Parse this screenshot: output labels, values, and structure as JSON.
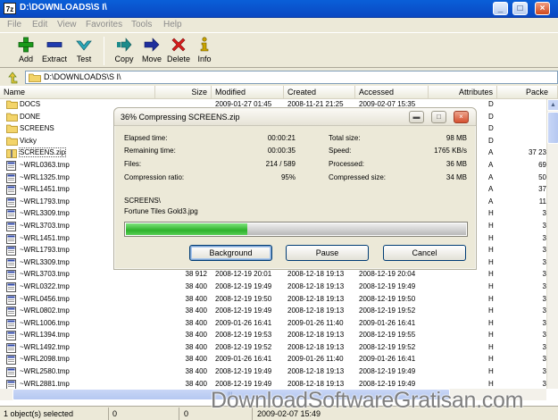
{
  "window": {
    "title": "D:\\DOWNLOADS\\S I\\"
  },
  "menu": [
    "File",
    "Edit",
    "View",
    "Favorites",
    "Tools",
    "Help"
  ],
  "toolbar": [
    {
      "label": "Add",
      "icon": "plus-icon",
      "color": "#1a9a1a"
    },
    {
      "label": "Extract",
      "icon": "minus-icon",
      "color": "#1f3bb0"
    },
    {
      "label": "Test",
      "icon": "check-icon",
      "color": "#2aa7b8"
    },
    {
      "label": "Copy",
      "icon": "copy-arrow-icon",
      "color": "#1d8b8b"
    },
    {
      "label": "Move",
      "icon": "move-arrow-icon",
      "color": "#1f2f9c"
    },
    {
      "label": "Delete",
      "icon": "delete-x-icon",
      "color": "#d81c1c"
    },
    {
      "label": "Info",
      "icon": "info-icon",
      "color": "#c9a400"
    }
  ],
  "address": {
    "path": "D:\\DOWNLOADS\\S I\\"
  },
  "columns": [
    "Name",
    "Size",
    "Modified",
    "Created",
    "Accessed",
    "Attributes",
    "Packe"
  ],
  "rows": [
    {
      "name": "DOCS",
      "type": "folder",
      "size": "",
      "modified": "2009-01-27 01:45",
      "created": "2008-11-21 21:25",
      "accessed": "2009-02-07 15:35",
      "attr": "D",
      "packed": ""
    },
    {
      "name": "DONE",
      "type": "folder",
      "size": "",
      "modified": "",
      "created": "",
      "accessed": "",
      "attr": "D",
      "packed": ""
    },
    {
      "name": "SCREENS",
      "type": "folder",
      "size": "",
      "modified": "",
      "created": "",
      "accessed": "",
      "attr": "D",
      "packed": ""
    },
    {
      "name": "Vicky",
      "type": "folder",
      "size": "",
      "modified": "",
      "created": "",
      "accessed": "",
      "attr": "D",
      "packed": ""
    },
    {
      "name": "SCREENS.zip",
      "type": "zip",
      "size": "",
      "modified": "",
      "created": "",
      "accessed": "",
      "attr": "A",
      "packed": "37 23"
    },
    {
      "name": "~WRL0363.tmp",
      "type": "file",
      "size": "",
      "modified": "",
      "created": "",
      "accessed": "",
      "attr": "A",
      "packed": "69"
    },
    {
      "name": "~WRL1325.tmp",
      "type": "file",
      "size": "",
      "modified": "",
      "created": "",
      "accessed": "",
      "attr": "A",
      "packed": "50"
    },
    {
      "name": "~WRL1451.tmp",
      "type": "file",
      "size": "",
      "modified": "",
      "created": "",
      "accessed": "",
      "attr": "A",
      "packed": "37"
    },
    {
      "name": "~WRL1793.tmp",
      "type": "file",
      "size": "",
      "modified": "",
      "created": "",
      "accessed": "",
      "attr": "A",
      "packed": "11"
    },
    {
      "name": "~WRL3309.tmp",
      "type": "file",
      "size": "",
      "modified": "",
      "created": "",
      "accessed": "",
      "attr": "H",
      "packed": "3"
    },
    {
      "name": "~WRL3703.tmp",
      "type": "file",
      "size": "",
      "modified": "",
      "created": "",
      "accessed": "",
      "attr": "H",
      "packed": "3"
    },
    {
      "name": "~WRL1451.tmp",
      "type": "file",
      "size": "",
      "modified": "",
      "created": "",
      "accessed": "",
      "attr": "H",
      "packed": "3"
    },
    {
      "name": "~WRL1793.tmp",
      "type": "file",
      "size": "",
      "modified": "",
      "created": "",
      "accessed": "",
      "attr": "H",
      "packed": "3"
    },
    {
      "name": "~WRL3309.tmp",
      "type": "file",
      "size": "",
      "modified": "",
      "created": "",
      "accessed": "",
      "attr": "H",
      "packed": "3"
    },
    {
      "name": "~WRL3703.tmp",
      "type": "file",
      "size": "38 912",
      "modified": "2008-12-19 20:01",
      "created": "2008-12-18 19:13",
      "accessed": "2008-12-19 20:04",
      "attr": "H",
      "packed": "3"
    },
    {
      "name": "~WRL0322.tmp",
      "type": "file",
      "size": "38 400",
      "modified": "2008-12-19 19:49",
      "created": "2008-12-18 19:13",
      "accessed": "2008-12-19 19:49",
      "attr": "H",
      "packed": "3"
    },
    {
      "name": "~WRL0456.tmp",
      "type": "file",
      "size": "38 400",
      "modified": "2008-12-19 19:50",
      "created": "2008-12-18 19:13",
      "accessed": "2008-12-19 19:50",
      "attr": "H",
      "packed": "3"
    },
    {
      "name": "~WRL0802.tmp",
      "type": "file",
      "size": "38 400",
      "modified": "2008-12-19 19:49",
      "created": "2008-12-18 19:13",
      "accessed": "2008-12-19 19:52",
      "attr": "H",
      "packed": "3"
    },
    {
      "name": "~WRL1006.tmp",
      "type": "file",
      "size": "38 400",
      "modified": "2009-01-26 16:41",
      "created": "2009-01-26 11:40",
      "accessed": "2009-01-26 16:41",
      "attr": "H",
      "packed": "3"
    },
    {
      "name": "~WRL1394.tmp",
      "type": "file",
      "size": "38 400",
      "modified": "2008-12-19 19:53",
      "created": "2008-12-18 19:13",
      "accessed": "2008-12-19 19:55",
      "attr": "H",
      "packed": "3"
    },
    {
      "name": "~WRL1492.tmp",
      "type": "file",
      "size": "38 400",
      "modified": "2008-12-19 19:52",
      "created": "2008-12-18 19:13",
      "accessed": "2008-12-19 19:52",
      "attr": "H",
      "packed": "3"
    },
    {
      "name": "~WRL2098.tmp",
      "type": "file",
      "size": "38 400",
      "modified": "2009-01-26 16:41",
      "created": "2009-01-26 11:40",
      "accessed": "2009-01-26 16:41",
      "attr": "H",
      "packed": "3"
    },
    {
      "name": "~WRL2580.tmp",
      "type": "file",
      "size": "38 400",
      "modified": "2008-12-19 19:49",
      "created": "2008-12-18 19:13",
      "accessed": "2008-12-19 19:49",
      "attr": "H",
      "packed": "3"
    },
    {
      "name": "~WRL2881.tmp",
      "type": "file",
      "size": "38 400",
      "modified": "2008-12-19 19:49",
      "created": "2008-12-18 19:13",
      "accessed": "2008-12-19 19:49",
      "attr": "H",
      "packed": "3"
    }
  ],
  "status": {
    "selected": "1 object(s) selected",
    "size": "0",
    "packed": "0",
    "date": "2009-02-07 15:49"
  },
  "dialog": {
    "title": "36% Compressing SCREENS.zip",
    "percent": 36,
    "left_labels": [
      "Elapsed time:",
      "Remaining time:",
      "Files:",
      "Compression ratio:"
    ],
    "left_values": [
      "00:00:21",
      "00:00:35",
      "214 / 589",
      "95%"
    ],
    "right_labels": [
      "Total size:",
      "Speed:",
      "Processed:",
      "Compressed size:"
    ],
    "right_values": [
      "98 MB",
      "1765 KB/s",
      "36 MB",
      "34 MB"
    ],
    "folder": "SCREENS\\",
    "file": "Fortune Tiles Gold3.jpg",
    "buttons": [
      "Background",
      "Pause",
      "Cancel"
    ]
  },
  "watermark": "DownloadSoftwareGratisan.com"
}
